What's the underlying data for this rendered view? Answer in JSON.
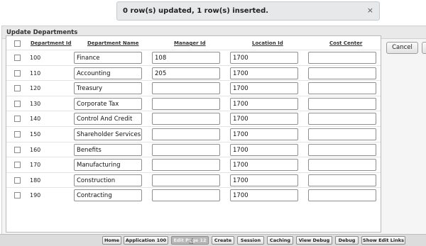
{
  "notification": {
    "message": "0 row(s) updated, 1 row(s) inserted.",
    "close": "×"
  },
  "region": {
    "title": "Update Departments"
  },
  "buttons": {
    "cancel": "Cancel"
  },
  "columns": {
    "department_id": "Department Id",
    "department_name": "Department Name",
    "manager_id": "Manager Id",
    "location_id": "Location Id",
    "cost_center": "Cost Center"
  },
  "rows": [
    {
      "id": "100",
      "name": "Finance",
      "manager": "108",
      "location": "1700",
      "cost": ""
    },
    {
      "id": "110",
      "name": "Accounting",
      "manager": "205",
      "location": "1700",
      "cost": ""
    },
    {
      "id": "120",
      "name": "Treasury",
      "manager": "",
      "location": "1700",
      "cost": ""
    },
    {
      "id": "130",
      "name": "Corporate Tax",
      "manager": "",
      "location": "1700",
      "cost": ""
    },
    {
      "id": "140",
      "name": "Control And Credit",
      "manager": "",
      "location": "1700",
      "cost": ""
    },
    {
      "id": "150",
      "name": "Shareholder Services",
      "manager": "",
      "location": "1700",
      "cost": ""
    },
    {
      "id": "160",
      "name": "Benefits",
      "manager": "",
      "location": "1700",
      "cost": ""
    },
    {
      "id": "170",
      "name": "Manufacturing",
      "manager": "",
      "location": "1700",
      "cost": ""
    },
    {
      "id": "180",
      "name": "Construction",
      "manager": "",
      "location": "1700",
      "cost": ""
    },
    {
      "id": "190",
      "name": "Contracting",
      "manager": "",
      "location": "1700",
      "cost": ""
    }
  ],
  "devbar": {
    "home": "Home",
    "application": "Application 100",
    "edit_page": "Edit Page 12",
    "create": "Create",
    "session": "Session",
    "caching": "Caching",
    "view_debug": "View Debug",
    "debug": "Debug",
    "show_edit_links": "Show Edit Links"
  }
}
